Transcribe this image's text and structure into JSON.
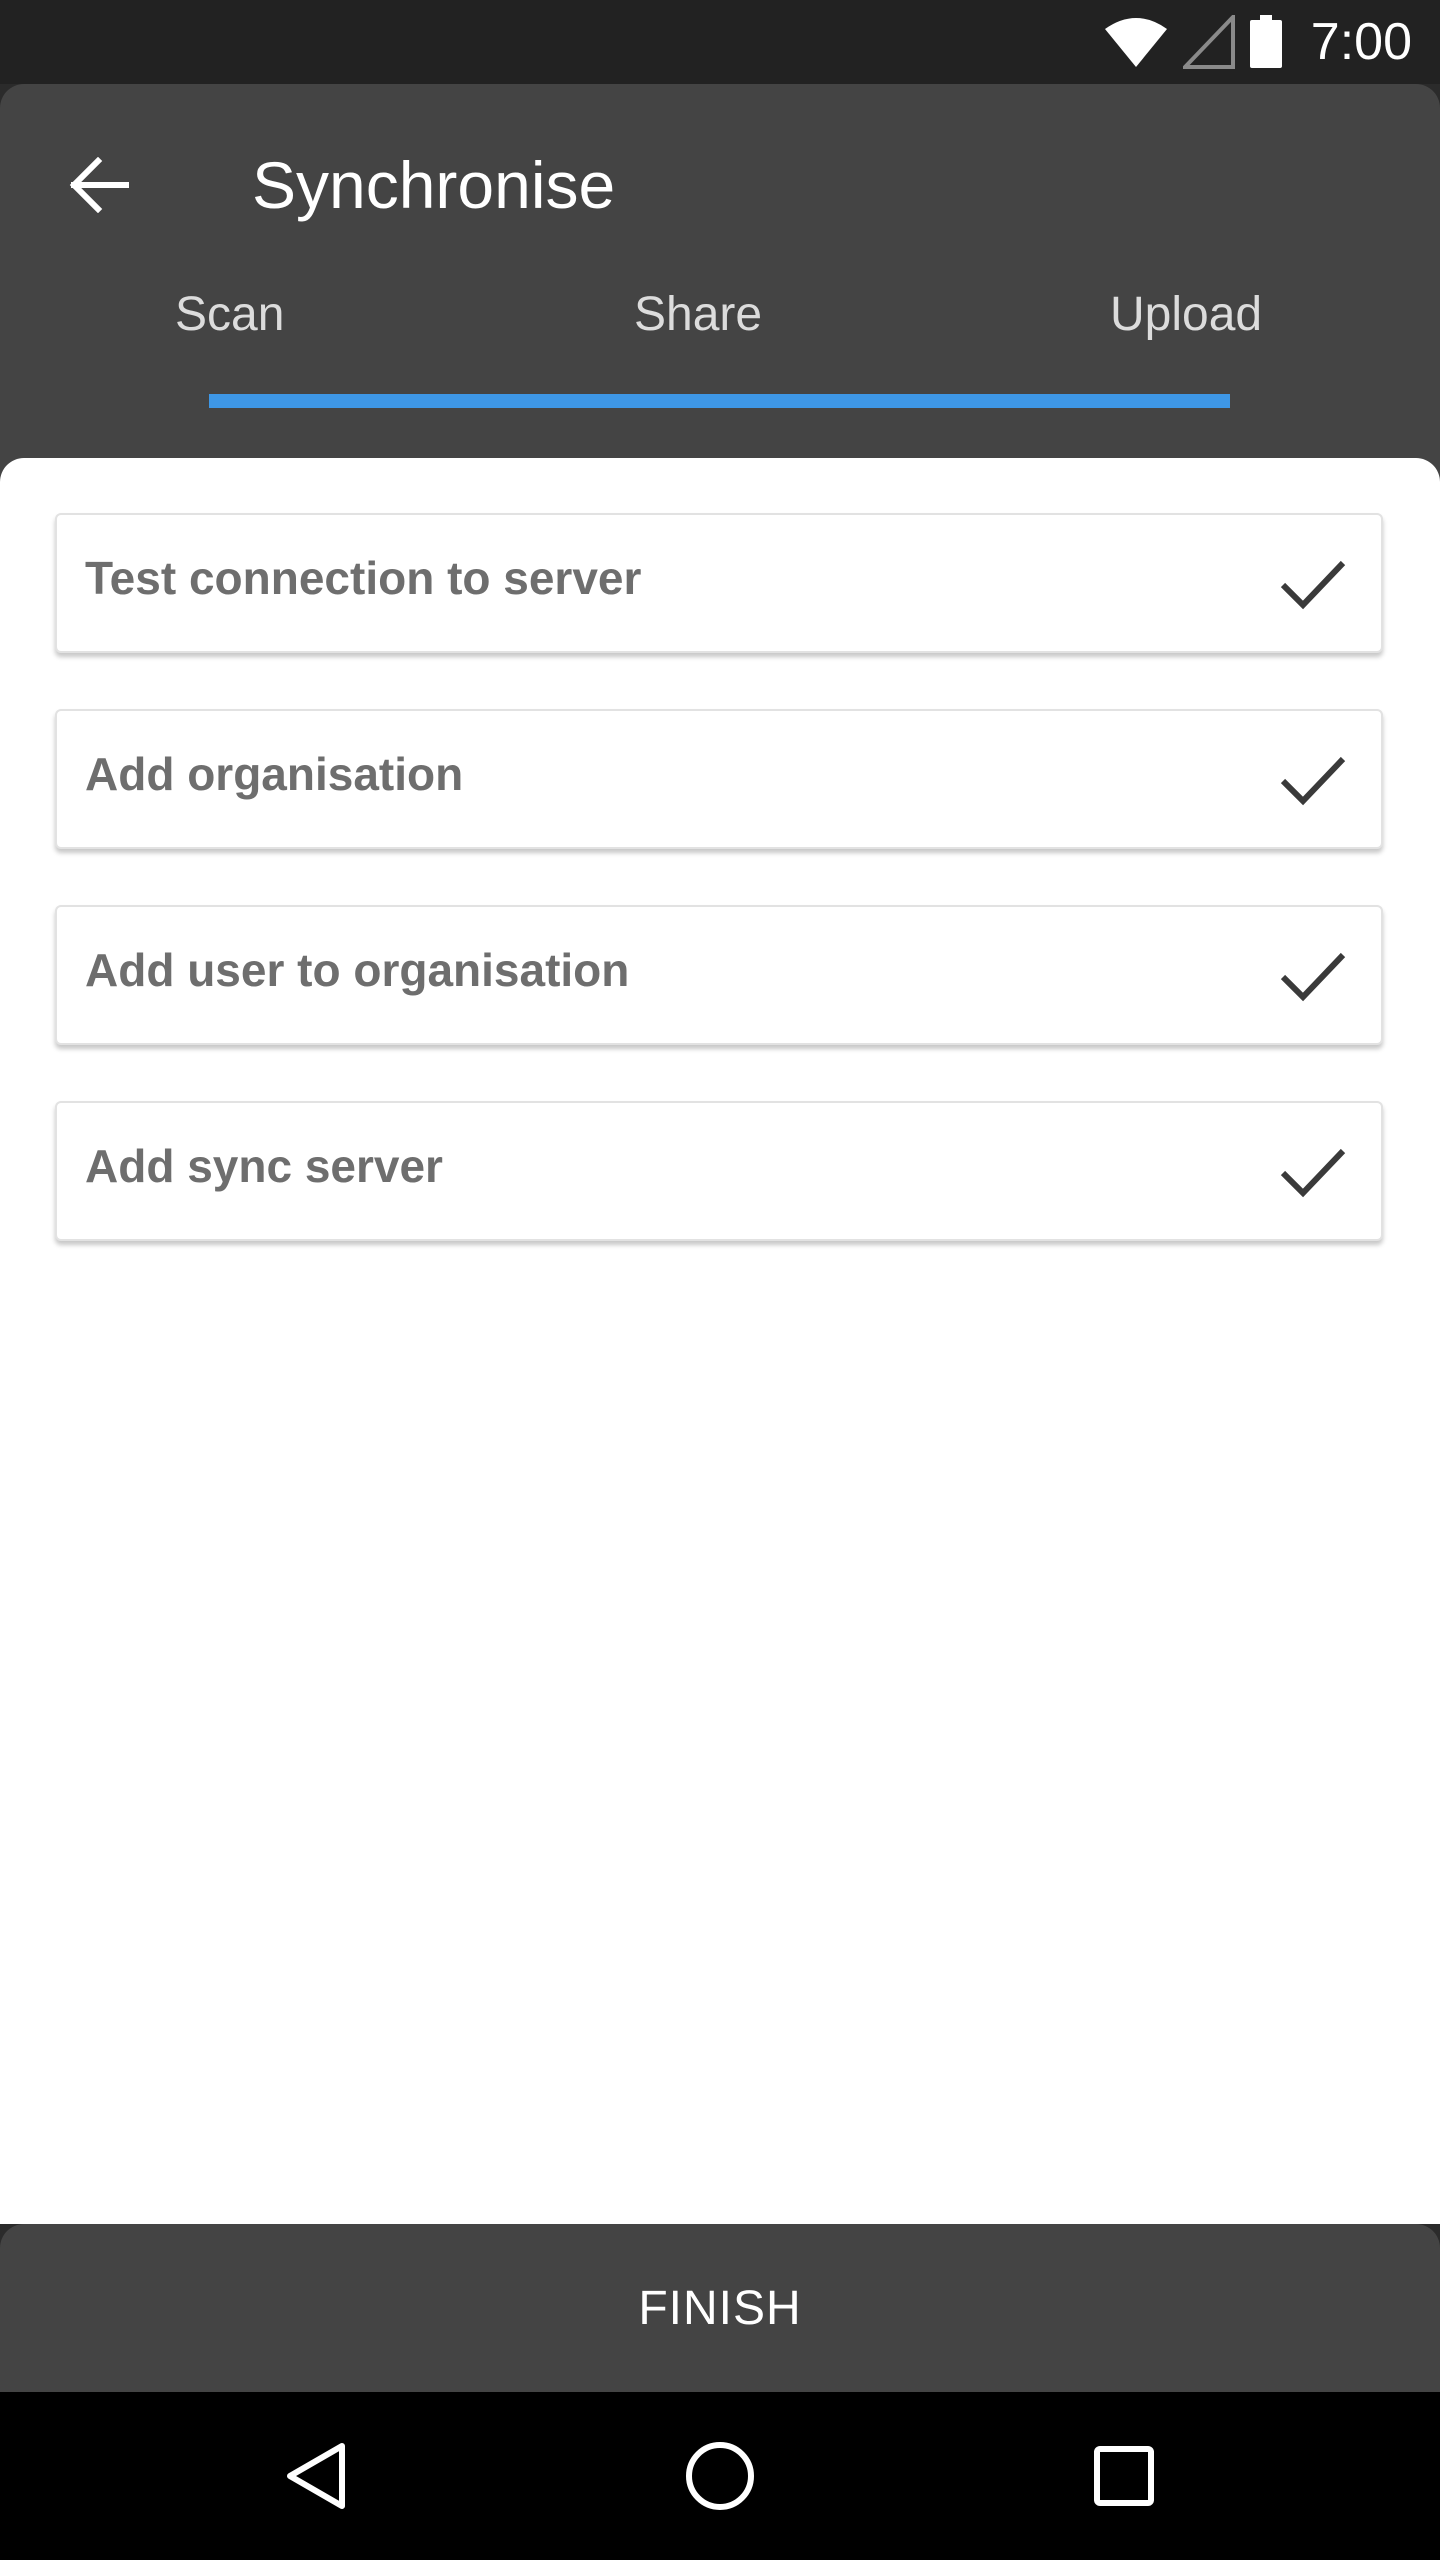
{
  "status_bar": {
    "time": "7:00",
    "icons": [
      "wifi-icon",
      "cellular-signal-icon",
      "battery-icon"
    ]
  },
  "app_bar": {
    "back_icon": "arrow-back-icon",
    "title": "Synchronise"
  },
  "tabs": [
    {
      "label": "Scan"
    },
    {
      "label": "Share"
    },
    {
      "label": "Upload"
    }
  ],
  "steps": [
    {
      "label": "Test connection to server",
      "status_icon": "check-icon"
    },
    {
      "label": "Add organisation",
      "status_icon": "check-icon"
    },
    {
      "label": "Add user to organisation",
      "status_icon": "check-icon"
    },
    {
      "label": "Add sync server",
      "status_icon": "check-icon"
    }
  ],
  "finish": {
    "label": "FINISH"
  },
  "nav_bar": {
    "icons": [
      "back-triangle-icon",
      "home-circle-icon",
      "recents-square-icon"
    ]
  },
  "colors": {
    "app_bar": "#444444",
    "status_bar": "#222222",
    "tab_indicator": "#3e97e6",
    "step_text": "#6e6e6e",
    "check": "#3a3a3a"
  }
}
